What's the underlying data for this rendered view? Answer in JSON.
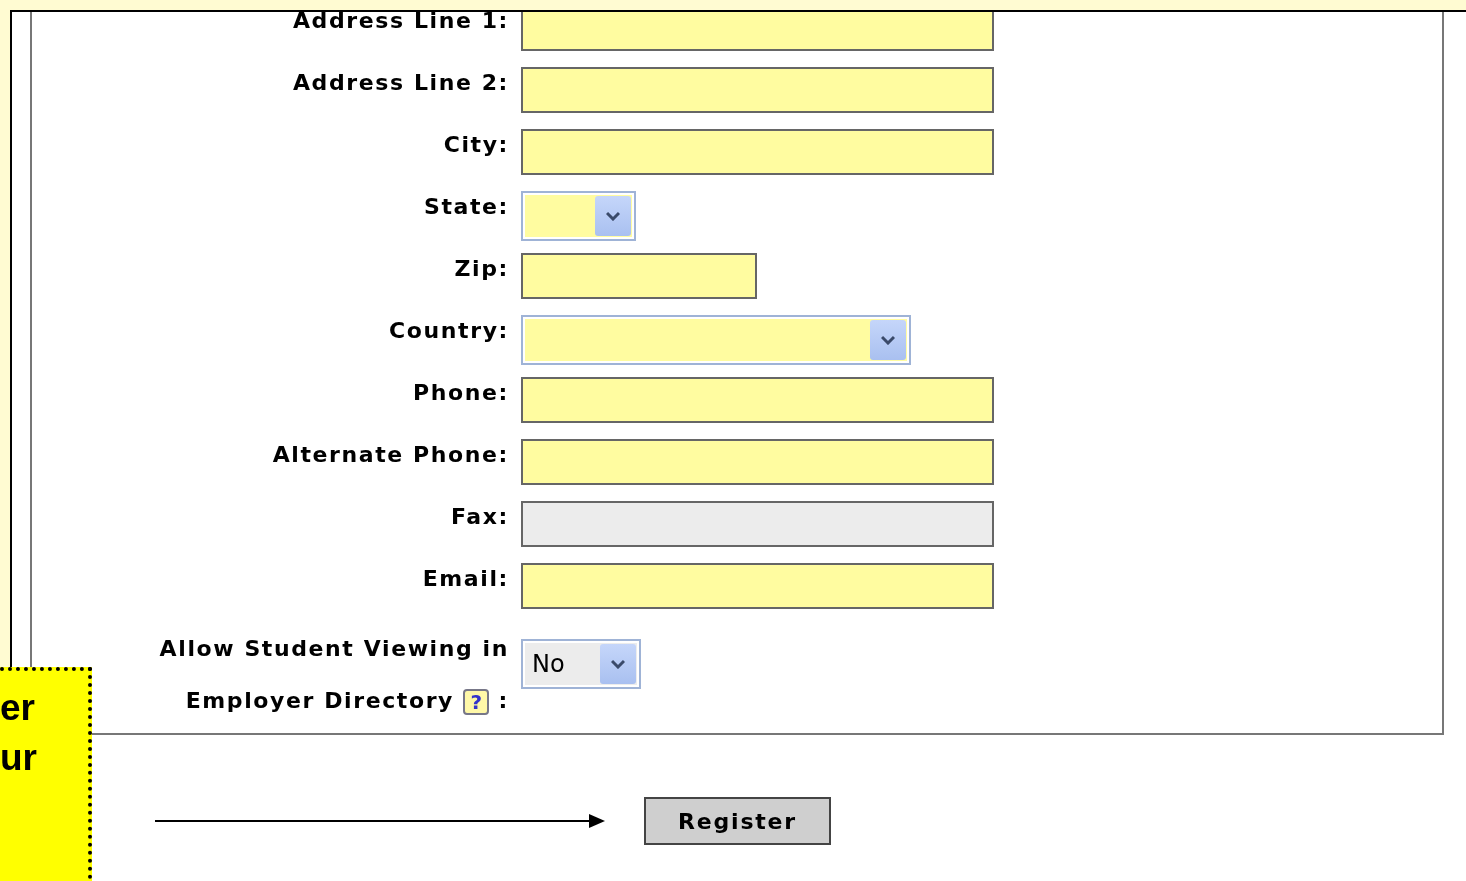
{
  "form": {
    "fields": [
      {
        "label": "Address Line 1:",
        "kind": "text",
        "required": true
      },
      {
        "label": "Address Line 2:",
        "kind": "text",
        "required": true
      },
      {
        "label": "City:",
        "kind": "text",
        "required": true
      },
      {
        "label": "State:",
        "kind": "select",
        "required": true
      },
      {
        "label": "Zip:",
        "kind": "short",
        "required": true
      },
      {
        "label": "Country:",
        "kind": "wide-select",
        "required": true
      },
      {
        "label": "Phone:",
        "kind": "text",
        "required": true
      },
      {
        "label": "Alternate Phone:",
        "kind": "text",
        "required": true
      },
      {
        "label": "Fax:",
        "kind": "text",
        "required": false
      },
      {
        "label": "Email:",
        "kind": "text",
        "required": true
      },
      {
        "label_lines": [
          "Allow Student Viewing in",
          "Employer Directory"
        ],
        "help": "?",
        "suffix": ":",
        "kind": "select",
        "required": false,
        "value": "No"
      }
    ]
  },
  "callout": {
    "lines": [
      "er",
      "ur"
    ]
  },
  "register_button": "Register"
}
